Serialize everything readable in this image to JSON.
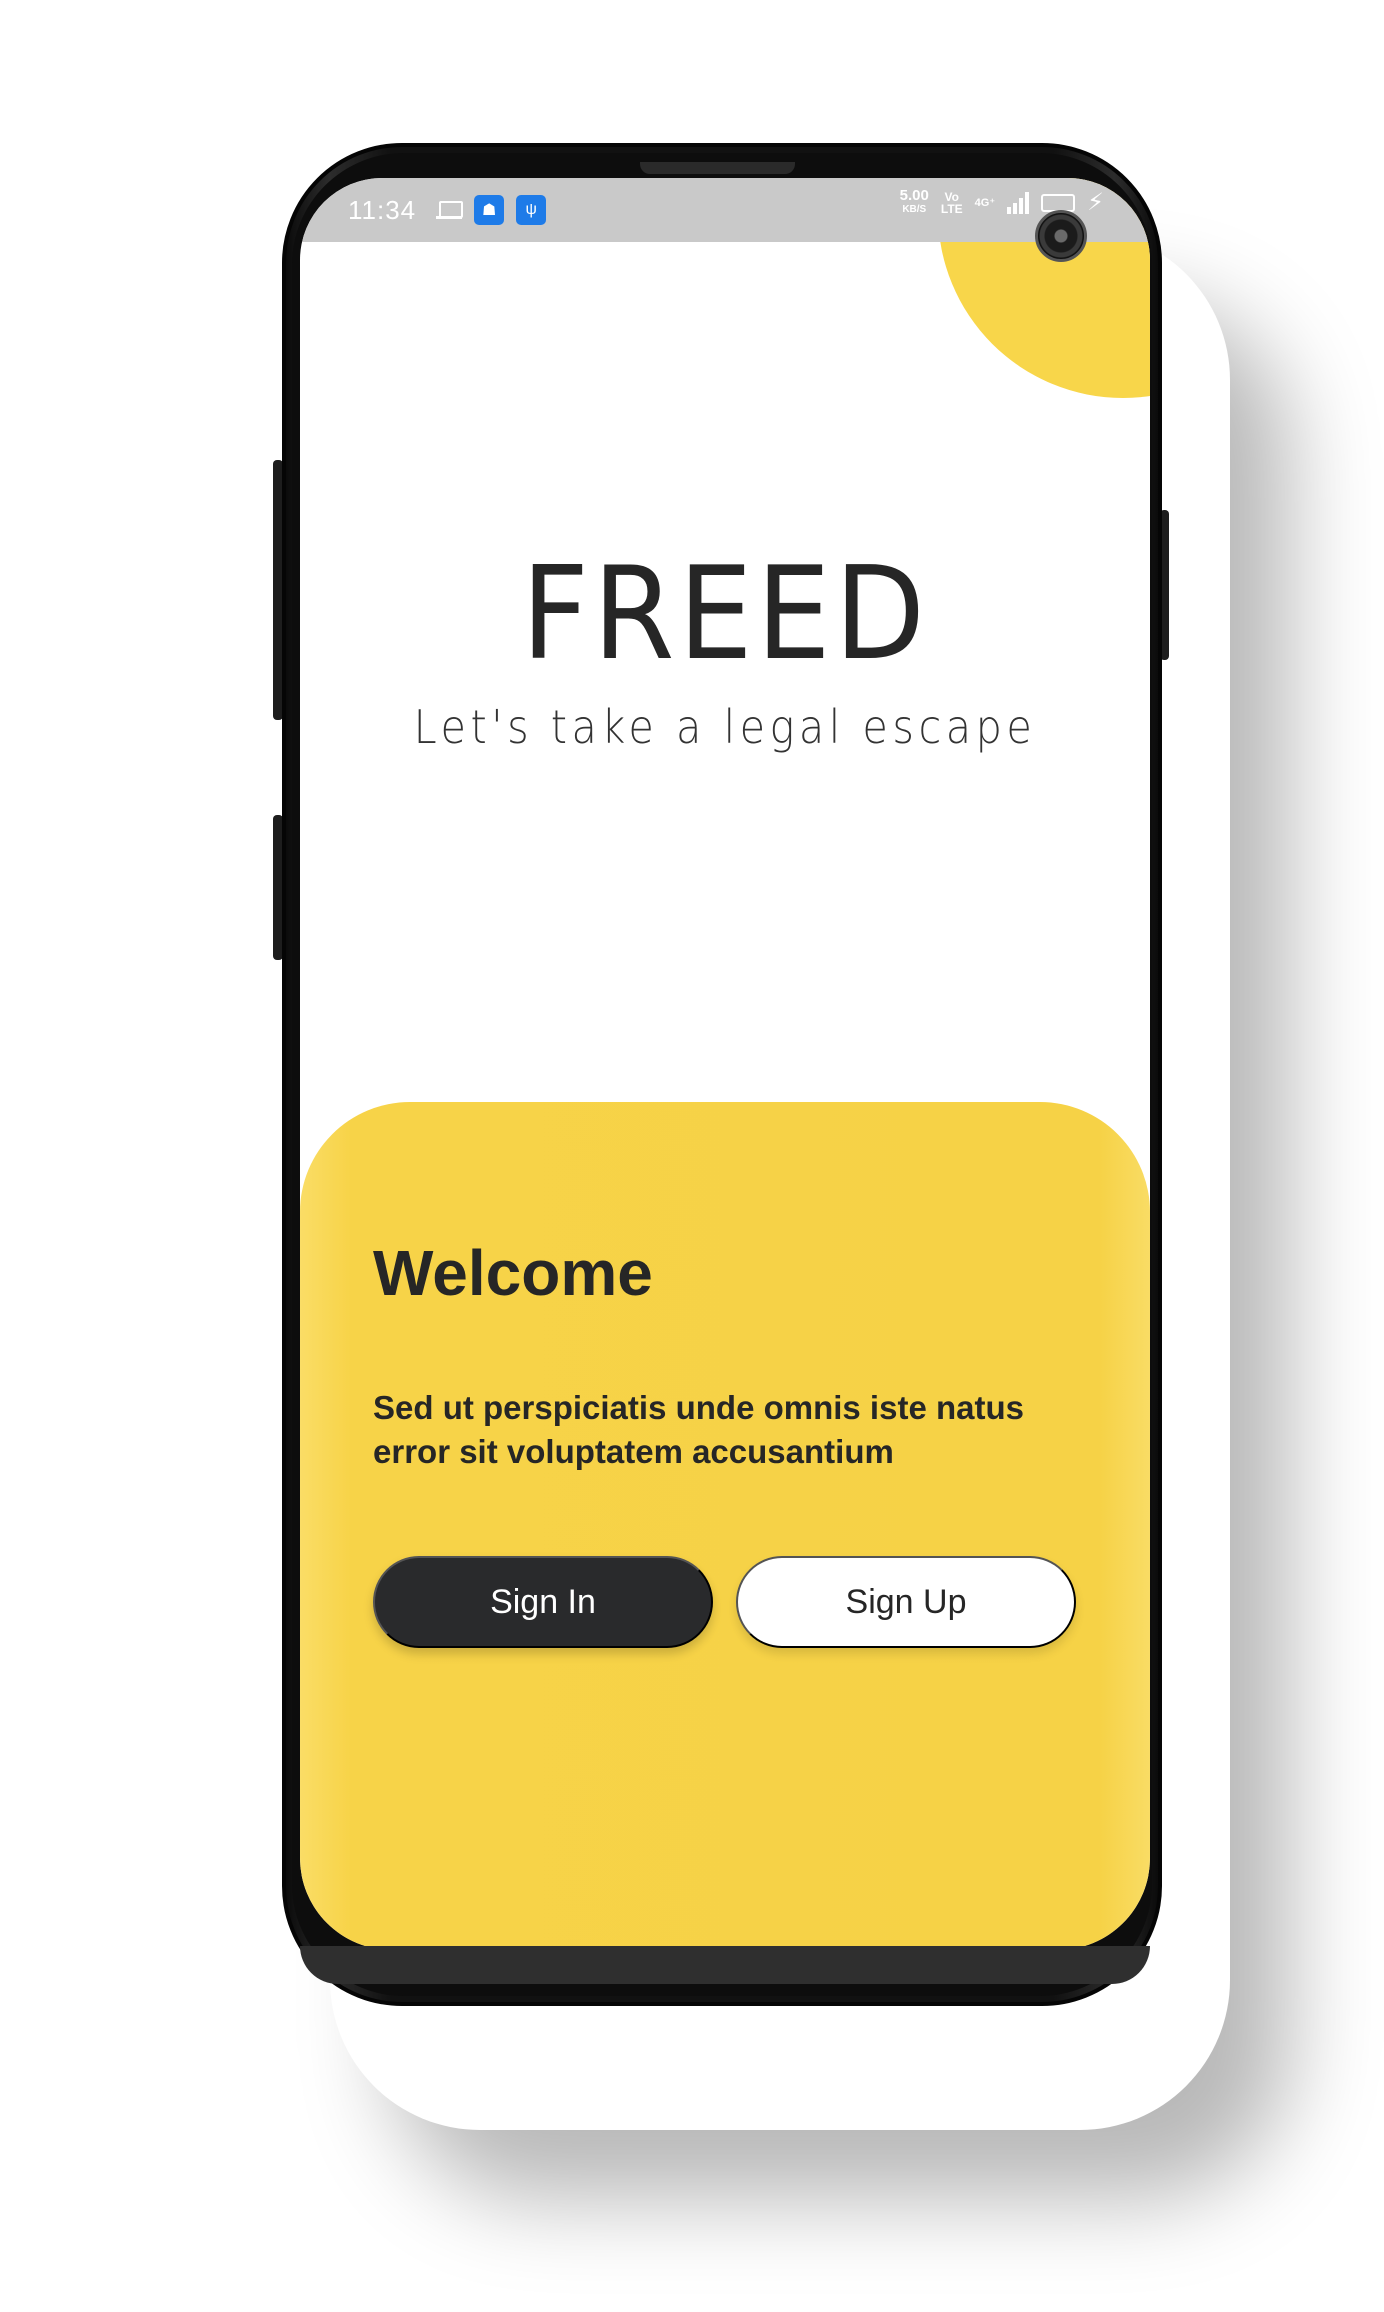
{
  "status_bar": {
    "time": "11:34",
    "speed_value": "5.00",
    "speed_unit": "KB/S",
    "volte_top": "Vo",
    "volte_bottom": "LTE",
    "network": "4G⁺"
  },
  "brand": {
    "title": "FREED",
    "tagline": "Let's take a legal escape"
  },
  "welcome": {
    "title": "Welcome",
    "body": "Sed ut perspiciatis unde omnis iste natus error sit voluptatem accusantium"
  },
  "buttons": {
    "sign_in": "Sign In",
    "sign_up": "Sign Up"
  },
  "colors": {
    "accent_yellow": "#f7d348",
    "dark": "#292a2c",
    "text": "#262626"
  }
}
